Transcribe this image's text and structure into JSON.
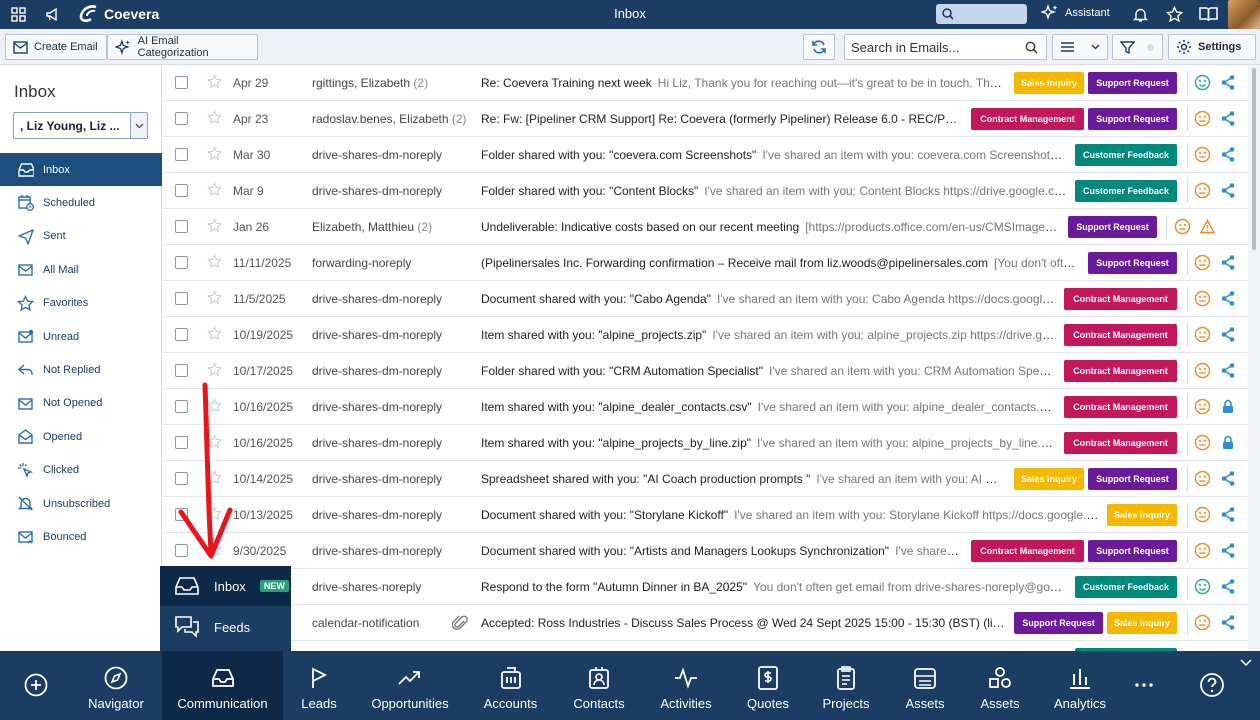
{
  "app": {
    "brand": "Coevera",
    "title": "Inbox",
    "assistant_label": "Assistant"
  },
  "toolbar": {
    "create_email": "Create Email",
    "ai_categorization": "AI Email Categorization",
    "search_placeholder": "Search in Emails...",
    "settings_label": "Settings"
  },
  "sidebar": {
    "title": "Inbox",
    "mailbox_select": ", Liz Young, Liz ...",
    "items": [
      {
        "label": "Inbox",
        "icon": "inbox-icon",
        "active": true
      },
      {
        "label": "Scheduled",
        "icon": "calendar-clock-icon"
      },
      {
        "label": "Sent",
        "icon": "send-icon"
      },
      {
        "label": "All Mail",
        "icon": "all-mail-icon"
      },
      {
        "label": "Favorites",
        "icon": "star-icon"
      },
      {
        "label": "Unread",
        "icon": "unread-icon"
      },
      {
        "label": "Not Replied",
        "icon": "reply-icon"
      },
      {
        "label": "Not Opened",
        "icon": "envelope-icon"
      },
      {
        "label": "Opened",
        "icon": "envelope-open-icon"
      },
      {
        "label": "Clicked",
        "icon": "click-icon"
      },
      {
        "label": "Unsubscribed",
        "icon": "unsubscribe-icon"
      },
      {
        "label": "Bounced",
        "icon": "bounced-icon"
      }
    ]
  },
  "tag_colors": {
    "Sales Inquiry": "#f5b800",
    "Support Request": "#6a1b9a",
    "Contract Management": "#c2185b",
    "Customer Feedback": "#00897b"
  },
  "emails": [
    {
      "date": "Apr 29",
      "from": "rgittings, Elizabeth",
      "count": "(2)",
      "subject": "Re: Coevera Training next week",
      "preview": "Hi Liz, Thank you for reaching out—it's great to be in touch. That w...",
      "tags": [
        "Sales Inquiry",
        "Support Request"
      ],
      "sentiment": "positive",
      "extra": ""
    },
    {
      "date": "Apr 23",
      "from": "radoslav.benes, Elizabeth",
      "count": "(2)",
      "subject": "Re: Fw: [Pipeliner CRM Support] Re: Coevera (formerly Pipeliner) Release 6.0 - REC/PRE RP...",
      "preview": "",
      "tags": [
        "Contract Management",
        "Support Request"
      ],
      "sentiment": "neutral",
      "extra": ""
    },
    {
      "date": "Mar 30",
      "from": "drive-shares-dm-noreply",
      "count": "",
      "subject": "Folder shared with you: \"coevera.com Screenshots\"",
      "preview": "I've shared an item with you: coevera.com Screenshots ht...",
      "tags": [
        "Customer Feedback"
      ],
      "sentiment": "neutral",
      "extra": ""
    },
    {
      "date": "Mar 9",
      "from": "drive-shares-dm-noreply",
      "count": "",
      "subject": "Folder shared with you: \"Content Blocks\"",
      "preview": "I've shared an item with you: Content Blocks https://drive.google.co...",
      "tags": [
        "Customer Feedback"
      ],
      "sentiment": "neutral",
      "extra": ""
    },
    {
      "date": "Jan 26",
      "from": "Elizabeth, Matthieu",
      "count": "(2)",
      "subject": "Undeliverable: Indicative costs based on our recent meeting",
      "preview": "[https://products.office.com/en-us/CMSImages...",
      "tags": [
        "Support Request"
      ],
      "sentiment": "neutral",
      "extra": "warning"
    },
    {
      "date": "11/11/2025",
      "from": "forwarding-noreply",
      "count": "",
      "subject": "(Pipelinersales Inc. Forwarding confirmation – Receive mail from liz.woods@pipelinersales.com",
      "preview": "[You don't often...",
      "tags": [
        "Support Request"
      ],
      "sentiment": "neutral",
      "extra": ""
    },
    {
      "date": "11/5/2025",
      "from": "drive-shares-dm-noreply",
      "count": "",
      "subject": "Document shared with you: \"Cabo Agenda\"",
      "preview": "I've shared an item with you: Cabo Agenda https://docs.google...",
      "tags": [
        "Contract Management"
      ],
      "sentiment": "neutral",
      "extra": ""
    },
    {
      "date": "10/19/2025",
      "from": "drive-shares-dm-noreply",
      "count": "",
      "subject": "Item shared with you: \"alpine_projects.zip\"",
      "preview": "I've shared an item with you: alpine_projects.zip https://drive.goo...",
      "tags": [
        "Contract Management"
      ],
      "sentiment": "neutral",
      "extra": ""
    },
    {
      "date": "10/17/2025",
      "from": "drive-shares-dm-noreply",
      "count": "",
      "subject": "Folder shared with you: \"CRM Automation Specialist\"",
      "preview": "I've shared an item with you: CRM Automation Special...",
      "tags": [
        "Contract Management"
      ],
      "sentiment": "neutral",
      "extra": ""
    },
    {
      "date": "10/16/2025",
      "from": "drive-shares-dm-noreply",
      "count": "",
      "subject": "Item shared with you: \"alpine_dealer_contacts.csv\"",
      "preview": "I've shared an item with you: alpine_dealer_contacts.csv ...",
      "tags": [
        "Contract Management"
      ],
      "sentiment": "neutral",
      "extra": "lock"
    },
    {
      "date": "10/16/2025",
      "from": "drive-shares-dm-noreply",
      "count": "",
      "subject": "Item shared with you: \"alpine_projects_by_line.zip\"",
      "preview": "I've shared an item with you: alpine_projects_by_line.zip ...",
      "tags": [
        "Contract Management"
      ],
      "sentiment": "neutral",
      "extra": "lock"
    },
    {
      "date": "10/14/2025",
      "from": "drive-shares-dm-noreply",
      "count": "",
      "subject": "Spreadsheet shared with you: \"AI Coach production prompts \"",
      "preview": "I've shared an item with you: AI Coa...",
      "tags": [
        "Sales Inquiry",
        "Support Request"
      ],
      "sentiment": "neutral",
      "extra": ""
    },
    {
      "date": "10/13/2025",
      "from": "drive-shares-dm-noreply",
      "count": "",
      "subject": "Document shared with you: \"Storylane Kickoff\"",
      "preview": "I've shared an item with you: Storylane Kickoff https://docs.google.c...",
      "tags": [
        "Sales Inquiry"
      ],
      "sentiment": "neutral",
      "extra": ""
    },
    {
      "date": "9/30/2025",
      "from": "drive-shares-dm-noreply",
      "count": "",
      "subject": "Document shared with you: \"Artists and Managers Lookups Synchronization\"",
      "preview": "I've shared a...",
      "tags": [
        "Contract Management",
        "Support Request"
      ],
      "sentiment": "neutral",
      "extra": ""
    },
    {
      "date": "",
      "from": "drive-shares-noreply",
      "count": "",
      "subject": "Respond to the form \"Autumn Dinner in BA_2025\"",
      "preview": "You don't often get email from drive-shares-noreply@googl...",
      "tags": [
        "Customer Feedback"
      ],
      "sentiment": "positive",
      "extra": ""
    },
    {
      "date": "",
      "from": "calendar-notification",
      "count": "",
      "subject": "Accepted: Ross Industries - Discuss Sales Process @ Wed 24 Sept 2025 15:00 - 15:30 (BST) (liz.w...",
      "preview": "",
      "tags": [
        "Support Request",
        "Sales Inquiry"
      ],
      "sentiment": "neutral",
      "extra": "",
      "attachment": true
    }
  ],
  "popup": {
    "inbox_label": "Inbox",
    "new_badge": "NEW",
    "feeds_label": "Feeds"
  },
  "bottom_nav": [
    {
      "label": "",
      "icon": "plus-circle-icon"
    },
    {
      "label": "Navigator",
      "icon": "compass-icon"
    },
    {
      "label": "Communication",
      "icon": "inbox-tray-icon",
      "active": true
    },
    {
      "label": "Leads",
      "icon": "flag-icon"
    },
    {
      "label": "Opportunities",
      "icon": "trend-icon"
    },
    {
      "label": "Accounts",
      "icon": "building-icon"
    },
    {
      "label": "Contacts",
      "icon": "contact-card-icon"
    },
    {
      "label": "Activities",
      "icon": "pulse-icon"
    },
    {
      "label": "Quotes",
      "icon": "dollar-doc-icon"
    },
    {
      "label": "Projects",
      "icon": "clipboard-icon"
    },
    {
      "label": "Assets",
      "icon": "box-icon"
    },
    {
      "label": "Assets",
      "icon": "shapes-icon"
    },
    {
      "label": "Analytics",
      "icon": "bar-chart-icon"
    },
    {
      "label": "",
      "icon": "more-icon"
    },
    {
      "label": "",
      "icon": "help-icon"
    }
  ]
}
